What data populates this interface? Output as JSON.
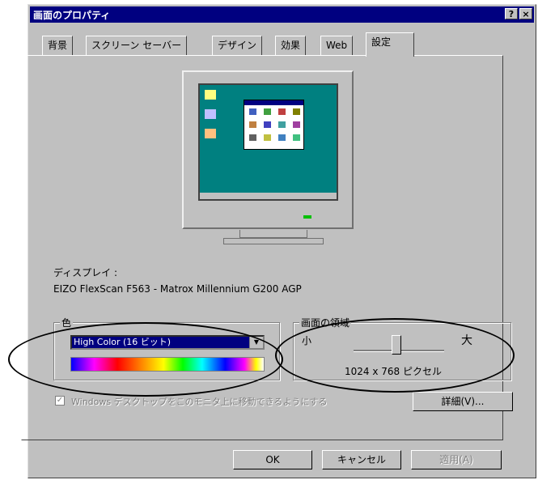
{
  "window": {
    "title": "画面のプロパティ",
    "help_btn": "?",
    "close_btn": "×"
  },
  "tabs": [
    {
      "label": "背景"
    },
    {
      "label": "スクリーン セーバー"
    },
    {
      "label": "デザイン"
    },
    {
      "label": "効果"
    },
    {
      "label": "Web"
    },
    {
      "label": "設定"
    }
  ],
  "display": {
    "label": "ディスプレイ :",
    "device": "EIZO FlexScan F563 - Matrox Millennium G200 AGP"
  },
  "color": {
    "group_label": "色",
    "selected": "High Color (16 ビット)",
    "arrow": "▼"
  },
  "resolution": {
    "group_label": "画面の領域",
    "small": "小",
    "large": "大",
    "value": "1024 x 768 ピクセル",
    "slider_fraction": 0.45
  },
  "checkbox": {
    "label": "Windows デスクトップをこのモニタ上に移動できるようにする",
    "checked": true,
    "mark": "✓"
  },
  "buttons": {
    "advanced": "詳細(V)...",
    "ok": "OK",
    "cancel": "キャンセル",
    "apply": "適用(A)"
  },
  "colors": {
    "titlebar": "#000080",
    "desktop": "#008080",
    "face": "#c0c0c0"
  }
}
